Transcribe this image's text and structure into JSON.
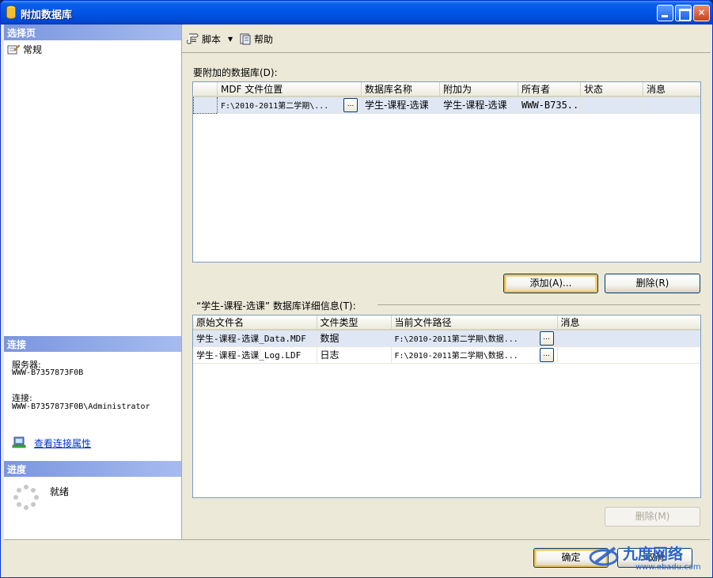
{
  "window": {
    "title": "附加数据库"
  },
  "left_panel": {
    "select_page_header": "选择页",
    "pages": [
      {
        "label": "常规"
      }
    ],
    "connection_header": "连接",
    "server_label": "服务器:",
    "server_value": "WWW-B7357873F0B",
    "connection_label": "连接:",
    "connection_value": "WWW-B7357873F0B\\Administrator",
    "view_connection_link": "查看连接属性",
    "progress_header": "进度",
    "progress_status": "就绪"
  },
  "toolbar": {
    "script_label": "脚本",
    "help_label": "帮助"
  },
  "attach_section": {
    "label": "要附加的数据库(D):",
    "columns": [
      "MDF 文件位置",
      "数据库名称",
      "附加为",
      "所有者",
      "状态",
      "消息"
    ],
    "rows": [
      {
        "mdf_location": "F:\\2010-2011第二学期\\...",
        "database_name": "学生-课程-选课",
        "attach_as": "学生-课程-选课",
        "owner": "WWW-B735...",
        "status": "",
        "message": ""
      }
    ],
    "ellipsis_label": "...",
    "add_button": "添加(A)...",
    "remove_button": "删除(R)"
  },
  "details_section": {
    "label": "“学生-课程-选课” 数据库详细信息(T):",
    "columns": [
      "原始文件名",
      "文件类型",
      "当前文件路径",
      "消息"
    ],
    "rows": [
      {
        "original_file": "学生-课程-选课_Data.MDF",
        "file_type": "数据",
        "current_path": "F:\\2010-2011第二学期\\数据...",
        "message": ""
      },
      {
        "original_file": "学生-课程-选课_Log.LDF",
        "file_type": "日志",
        "current_path": "F:\\2010-2011第二学期\\数据...",
        "message": ""
      }
    ],
    "ellipsis_label": "...",
    "remove_button": "删除(M)"
  },
  "footer": {
    "ok_button": "确定",
    "cancel_button": "取消"
  },
  "watermark": {
    "brand": "九度网络",
    "url": "www.ebadu.com"
  },
  "colors": {
    "titlebar": "#0055e5",
    "section_header": "#7a96df",
    "selected_row": "#dfe7f5",
    "link": "#0033cc"
  }
}
